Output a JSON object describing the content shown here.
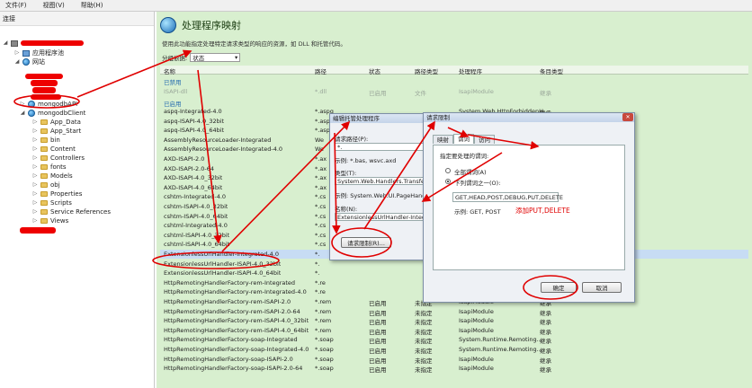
{
  "menu": {
    "file": "文件(F)",
    "view": "视图(V)",
    "help": "帮助(H)"
  },
  "left": {
    "header": "连接",
    "tree": [
      {
        "label": "应用程序池",
        "level": 1,
        "icon": "app"
      },
      {
        "label": "网站",
        "level": 1,
        "icon": "globe"
      },
      {
        "label": "mongodbAPI",
        "level": 2,
        "icon": "globe"
      },
      {
        "label": "mongodbClient",
        "level": 2,
        "icon": "globe"
      },
      {
        "label": "App_Data",
        "level": 3,
        "icon": "folder"
      },
      {
        "label": "App_Start",
        "level": 3,
        "icon": "folder"
      },
      {
        "label": "bin",
        "level": 3,
        "icon": "folder"
      },
      {
        "label": "Content",
        "level": 3,
        "icon": "folder"
      },
      {
        "label": "Controllers",
        "level": 3,
        "icon": "folder"
      },
      {
        "label": "fonts",
        "level": 3,
        "icon": "folder"
      },
      {
        "label": "Models",
        "level": 3,
        "icon": "folder"
      },
      {
        "label": "obj",
        "level": 3,
        "icon": "folder"
      },
      {
        "label": "Properties",
        "level": 3,
        "icon": "folder"
      },
      {
        "label": "Scripts",
        "level": 3,
        "icon": "folder"
      },
      {
        "label": "Service References",
        "level": 3,
        "icon": "folder"
      },
      {
        "label": "Views",
        "level": 3,
        "icon": "folder"
      }
    ]
  },
  "main": {
    "title": "处理程序映射",
    "description": "使用此功能指定处理特定请求类型的响应的资源，如 DLL 和托管代码。",
    "group_label": "分组依据:",
    "group_value": "状态",
    "columns": [
      "名称",
      "路径",
      "状态",
      "路径类型",
      "处理程序",
      "条目类型"
    ],
    "group_disabled": "已禁用",
    "group_enabled": "已启用",
    "disabled_row": {
      "name": "ISAPI-dll",
      "path": "*.dll",
      "state": "已启用",
      "ptype": "文件",
      "handler": "IsapiModule",
      "entry": "继承"
    },
    "rows": [
      {
        "name": "aspq-Integrated-4.0",
        "path": "*.aspq",
        "state": "",
        "ptype": "",
        "handler": "",
        "entry": ""
      },
      {
        "name": "aspq-ISAPI-4.0_32bit",
        "path": "*.aspq",
        "state": "",
        "ptype": "",
        "handler": "",
        "entry": ""
      },
      {
        "name": "aspq-ISAPI-4.0_64bit",
        "path": "*.aspq",
        "state": "",
        "ptype": "",
        "handler": "",
        "entry": ""
      },
      {
        "name": "AssemblyResourceLoader-Integrated",
        "path": "We",
        "state": "",
        "ptype": "",
        "handler": "",
        "entry": ""
      },
      {
        "name": "AssemblyResourceLoader-Integrated-4.0",
        "path": "We",
        "state": "",
        "ptype": "",
        "handler": "",
        "entry": ""
      },
      {
        "name": "AXD-ISAPI-2.0",
        "path": "*.ax",
        "state": "",
        "ptype": "",
        "handler": "",
        "entry": ""
      },
      {
        "name": "AXD-ISAPI-2.0-64",
        "path": "*.ax",
        "state": "",
        "ptype": "",
        "handler": "",
        "entry": ""
      },
      {
        "name": "AXD-ISAPI-4.0_32bit",
        "path": "*.ax",
        "state": "",
        "ptype": "",
        "handler": "",
        "entry": ""
      },
      {
        "name": "AXD-ISAPI-4.0_64bit",
        "path": "*.ax",
        "state": "",
        "ptype": "",
        "handler": "",
        "entry": ""
      },
      {
        "name": "cshtm-Integrated-4.0",
        "path": "*.cs",
        "state": "",
        "ptype": "",
        "handler": "",
        "entry": ""
      },
      {
        "name": "cshtm-ISAPI-4.0_32bit",
        "path": "*.cs",
        "state": "",
        "ptype": "",
        "handler": "",
        "entry": ""
      },
      {
        "name": "cshtm-ISAPI-4.0_64bit",
        "path": "*.cs",
        "state": "",
        "ptype": "",
        "handler": "",
        "entry": ""
      },
      {
        "name": "cshtml-Integrated-4.0",
        "path": "*.cs",
        "state": "",
        "ptype": "",
        "handler": "",
        "entry": ""
      },
      {
        "name": "cshtml-ISAPI-4.0_32bit",
        "path": "*.cs",
        "state": "",
        "ptype": "",
        "handler": "",
        "entry": ""
      },
      {
        "name": "cshtml-ISAPI-4.0_64bit",
        "path": "*.cs",
        "state": "",
        "ptype": "",
        "handler": "",
        "entry": ""
      },
      {
        "name": "ExtensionlessUrlHandler-Integrated-4.0",
        "path": "*.",
        "state": "",
        "ptype": "",
        "handler": "",
        "entry": ""
      },
      {
        "name": "ExtensionlessUrlHandler-ISAPI-4.0_32bit",
        "path": "*.",
        "state": "",
        "ptype": "",
        "handler": "",
        "entry": ""
      },
      {
        "name": "ExtensionlessUrlHandler-ISAPI-4.0_64bit",
        "path": "*.",
        "state": "",
        "ptype": "",
        "handler": "",
        "entry": ""
      },
      {
        "name": "HttpRemotingHandlerFactory-rem-Integrated",
        "path": "*.re",
        "state": "",
        "ptype": "",
        "handler": "",
        "entry": ""
      },
      {
        "name": "HttpRemotingHandlerFactory-rem-Integrated-4.0",
        "path": "*.re",
        "state": "",
        "ptype": "",
        "handler": "",
        "entry": ""
      },
      {
        "name": "HttpRemotingHandlerFactory-rem-ISAPI-2.0",
        "path": "*.rem",
        "state": "已启用",
        "ptype": "未指定",
        "handler": "IsapiModule",
        "entry": "继承"
      },
      {
        "name": "HttpRemotingHandlerFactory-rem-ISAPI-2.0-64",
        "path": "*.rem",
        "state": "已启用",
        "ptype": "未指定",
        "handler": "IsapiModule",
        "entry": "继承"
      },
      {
        "name": "HttpRemotingHandlerFactory-rem-ISAPI-4.0_32bit",
        "path": "*.rem",
        "state": "已启用",
        "ptype": "未指定",
        "handler": "IsapiModule",
        "entry": "继承"
      },
      {
        "name": "HttpRemotingHandlerFactory-rem-ISAPI-4.0_64bit",
        "path": "*.rem",
        "state": "已启用",
        "ptype": "未指定",
        "handler": "IsapiModule",
        "entry": "继承"
      },
      {
        "name": "HttpRemotingHandlerFactory-soap-Integrated",
        "path": "*.soap",
        "state": "已启用",
        "ptype": "未指定",
        "handler": "System.Runtime.Remoting...",
        "entry": "继承"
      },
      {
        "name": "HttpRemotingHandlerFactory-soap-Integrated-4.0",
        "path": "*.soap",
        "state": "已启用",
        "ptype": "未指定",
        "handler": "System.Runtime.Remoting...",
        "entry": "继承"
      },
      {
        "name": "HttpRemotingHandlerFactory-soap-ISAPI-2.0",
        "path": "*.soap",
        "state": "已启用",
        "ptype": "未指定",
        "handler": "IsapiModule",
        "entry": "继承"
      },
      {
        "name": "HttpRemotingHandlerFactory-soap-ISAPI-2.0-64",
        "path": "*.soap",
        "state": "已启用",
        "ptype": "未指定",
        "handler": "IsapiModule",
        "entry": "继承"
      }
    ],
    "peek_row": {
      "handler": "System.Web.HttpForbiddenH...",
      "entry": "继承"
    }
  },
  "edit_dialog": {
    "title": "编辑托管处理程序",
    "request_path_label": "请求路径(P):",
    "request_path_value": "*.",
    "example": "示例: *.bas, wsvc.axd",
    "type_label": "类型(T):",
    "type_value": "System.Web.Handlers.TransferRequ...",
    "type_example": "示例: System.Web.UI.PageHandlerF...",
    "name_label": "名称(N):",
    "name_value": "ExtensionlessUrlHandler-Integrat...",
    "restrict_button": "请求限制(R)..."
  },
  "restrict_dialog": {
    "title": "请求限制",
    "tabs": [
      "映射",
      "谓词",
      "访问"
    ],
    "heading": "指定要处理的谓词:",
    "option_all": "全部谓词(A)",
    "option_one": "下列谓词之一(O):",
    "verbs_value": "GET,HEAD,POST,DEBUG,PUT,DELETE",
    "example": "示例: GET, POST",
    "annotation": "添加PUT,DELETE",
    "ok": "确定",
    "cancel": "取消"
  },
  "colors": {
    "accent": "#d9efcf",
    "annotation": "#e00000"
  }
}
